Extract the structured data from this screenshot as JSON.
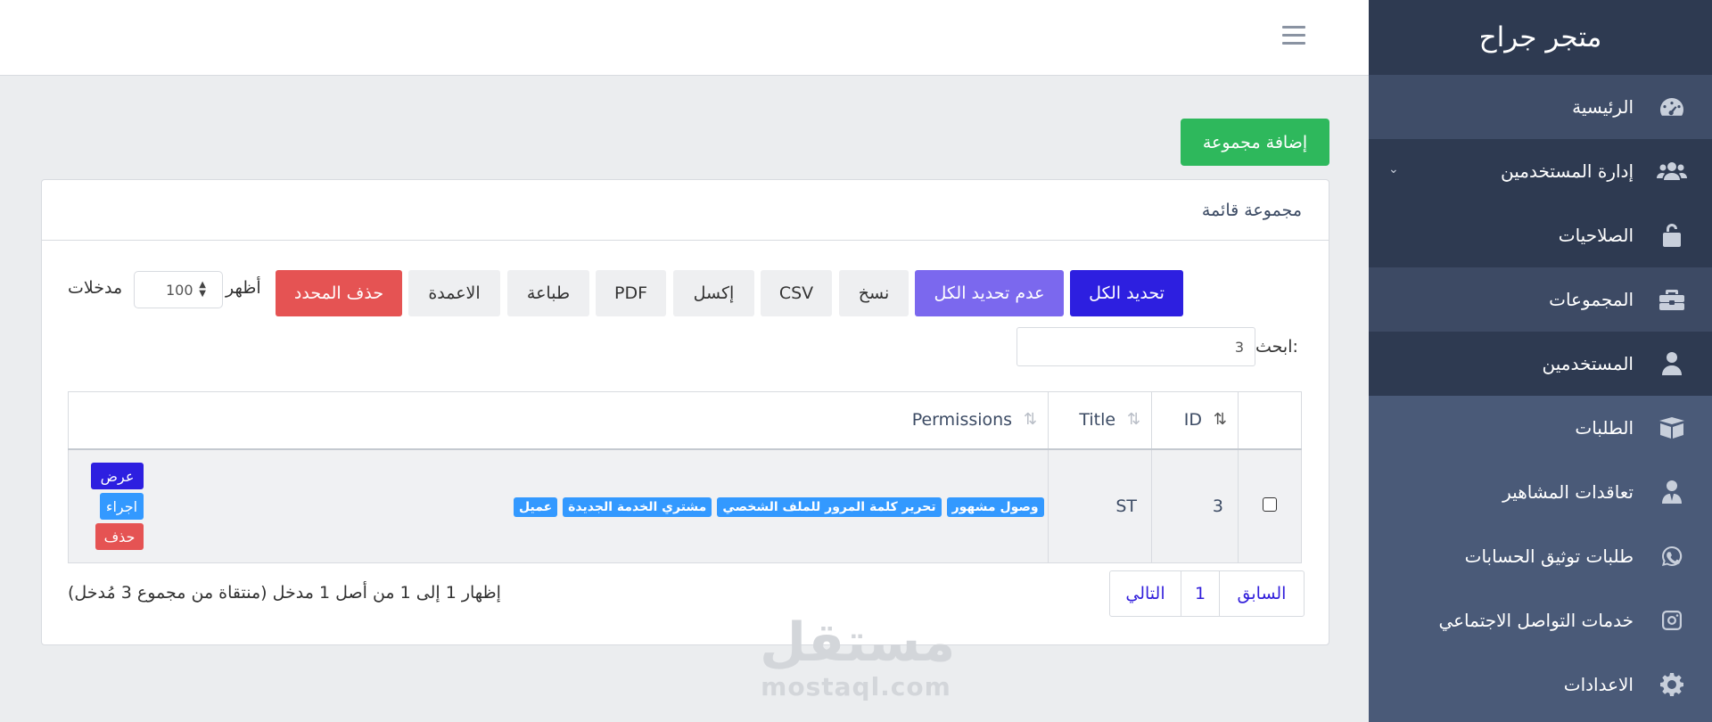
{
  "sidebar": {
    "brand": "متجر جراح",
    "items": [
      {
        "label": "الرئيسية",
        "icon": "speedometer-icon"
      },
      {
        "label": "إدارة المستخدمين",
        "icon": "users-icon"
      },
      {
        "label": "الصلاحيات",
        "icon": "lock-icon"
      },
      {
        "label": "المجموعات",
        "icon": "briefcase-icon"
      },
      {
        "label": "المستخدمين",
        "icon": "user-icon"
      },
      {
        "label": "الطلبات",
        "icon": "box-icon"
      },
      {
        "label": "تعاقدات المشاهير",
        "icon": "user-tie-icon"
      },
      {
        "label": "طلبات توثيق الحسابات",
        "icon": "whatsapp-icon"
      },
      {
        "label": "خدمات التواصل الاجتماعي",
        "icon": "instagram-icon"
      },
      {
        "label": "الاعدادات",
        "icon": "gear-icon"
      }
    ]
  },
  "main": {
    "add_group": "إضافة مجموعة",
    "card_title": "مجموعة قائمة"
  },
  "toolbar": {
    "select_all": "تحديد الكل",
    "deselect_all": "عدم تحديد الكل",
    "copy": "نسخ",
    "csv": "CSV",
    "excel": "إكسل",
    "pdf": "PDF",
    "print": "طباعة",
    "columns": "الاعمدة",
    "delete_selected": "حذف المحدد",
    "show": "أظهر",
    "page_size": "100",
    "entries": "مدخلات",
    "search_label": "ابحث:",
    "search_value": "3"
  },
  "table": {
    "headers": {
      "id": "ID",
      "title": "Title",
      "permissions": "Permissions"
    },
    "rows": [
      {
        "id": "3",
        "title": "ST",
        "permissions": [
          "عميل",
          "مشتري الخدمة الجديدة",
          "تحرير كلمة المرور للملف الشخصي",
          "وصول مشهور"
        ],
        "actions": {
          "view": "عرض",
          "edit": "اجراء",
          "delete": "حذف"
        }
      }
    ]
  },
  "footer": {
    "info": "إظهار 1 إلى 1 من أصل 1 مدخل (منتقاة من مجموع 3 مُدخل)",
    "prev": "السابق",
    "page": "1",
    "next": "التالي"
  },
  "watermark": {
    "ar": "مستقل",
    "en": "mostaql.com"
  },
  "colors": {
    "sidebar": "#4a5a78",
    "brand_bar": "#2e3a51",
    "success": "#2eb85c",
    "primary": "#2d1fe0",
    "secondary": "#7b68ee",
    "danger": "#e55353",
    "info": "#3399ff"
  }
}
